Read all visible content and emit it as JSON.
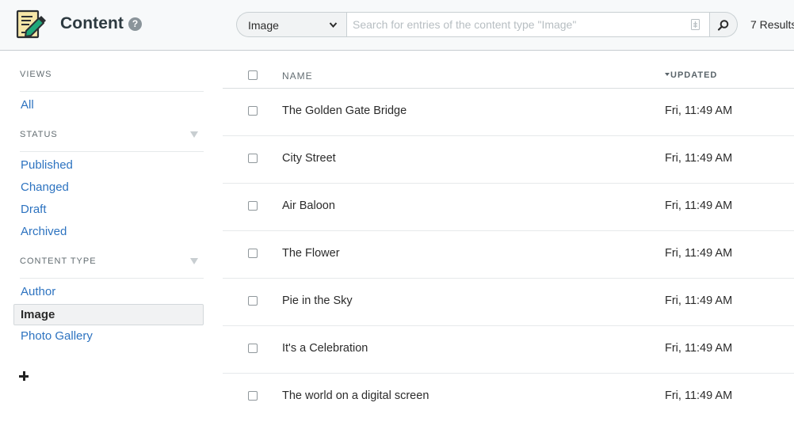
{
  "header": {
    "title": "Content",
    "help_icon": "question-circle-icon",
    "content_type_select": {
      "selected": "Image"
    },
    "search": {
      "placeholder": "Search for entries of the content type \"Image\"",
      "value": ""
    },
    "results_count": "7 Results"
  },
  "sidebar": {
    "views_heading": "VIEWS",
    "views": [
      {
        "label": "All"
      }
    ],
    "status_heading": "STATUS",
    "status_items": [
      {
        "label": "Published"
      },
      {
        "label": "Changed"
      },
      {
        "label": "Draft"
      },
      {
        "label": "Archived"
      }
    ],
    "content_type_heading": "CONTENT TYPE",
    "content_types": [
      {
        "label": "Author",
        "active": false
      },
      {
        "label": "Image",
        "active": true
      },
      {
        "label": "Photo Gallery",
        "active": false
      }
    ],
    "add_icon": "plus-icon"
  },
  "table": {
    "columns": {
      "name": "NAME",
      "updated": "UPDATED"
    },
    "sort_column": "updated",
    "rows": [
      {
        "name": "The Golden Gate Bridge",
        "updated": "Fri, 11:49 AM"
      },
      {
        "name": "City Street",
        "updated": "Fri, 11:49 AM"
      },
      {
        "name": "Air Baloon",
        "updated": "Fri, 11:49 AM"
      },
      {
        "name": "The Flower",
        "updated": "Fri, 11:49 AM"
      },
      {
        "name": "Pie in the Sky",
        "updated": "Fri, 11:49 AM"
      },
      {
        "name": "It's a Celebration",
        "updated": "Fri, 11:49 AM"
      },
      {
        "name": "The world on a digital screen",
        "updated": "Fri, 11:49 AM"
      }
    ]
  },
  "colors": {
    "link": "#2d73c0",
    "header_bg": "#f7f9fa",
    "logo_accent": "#1fa87a"
  }
}
